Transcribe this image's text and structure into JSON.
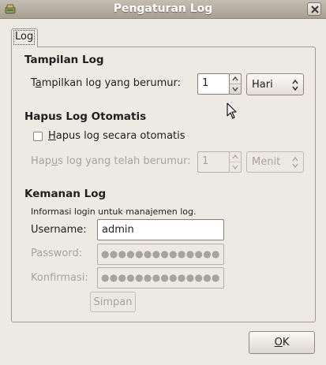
{
  "window": {
    "title": "Pengaturan Log"
  },
  "tabs": [
    {
      "label": "Log"
    }
  ],
  "display": {
    "heading": "Tampilan Log",
    "show_label_pre": "T",
    "show_label_mn": "a",
    "show_label_post": "mpilkan log yang berumur:",
    "value": "1",
    "unit": "Hari"
  },
  "auto_delete": {
    "heading": "Hapus Log Otomatis",
    "checkbox_label_mn": "H",
    "checkbox_label_rest": "apus log secara otomatis",
    "checked": false,
    "age_label_pre": "Hap",
    "age_label_mn": "u",
    "age_label_post": "s log yang telah berumur:",
    "value": "1",
    "unit": "Menit"
  },
  "security": {
    "heading": "Kemanan Log",
    "info": "Informasi login untuk manajemen log.",
    "username_label": "Username:",
    "username_value": "admin",
    "password_label": "Password:",
    "password_value": "●●●●●●●●●●●●●●",
    "confirm_label": "Konfirmasi:",
    "confirm_value": "●●●●●●●●●●●●●●",
    "save_label": "Simpan"
  },
  "footer": {
    "ok_mn": "O",
    "ok_rest": "K"
  },
  "icons": {
    "app": "log-settings-icon",
    "close": "close-icon",
    "spin_up": "chevron-up-icon",
    "spin_down": "chevron-down-icon",
    "combo": "updown-arrows-icon",
    "cursor": "mouse-pointer-icon"
  }
}
